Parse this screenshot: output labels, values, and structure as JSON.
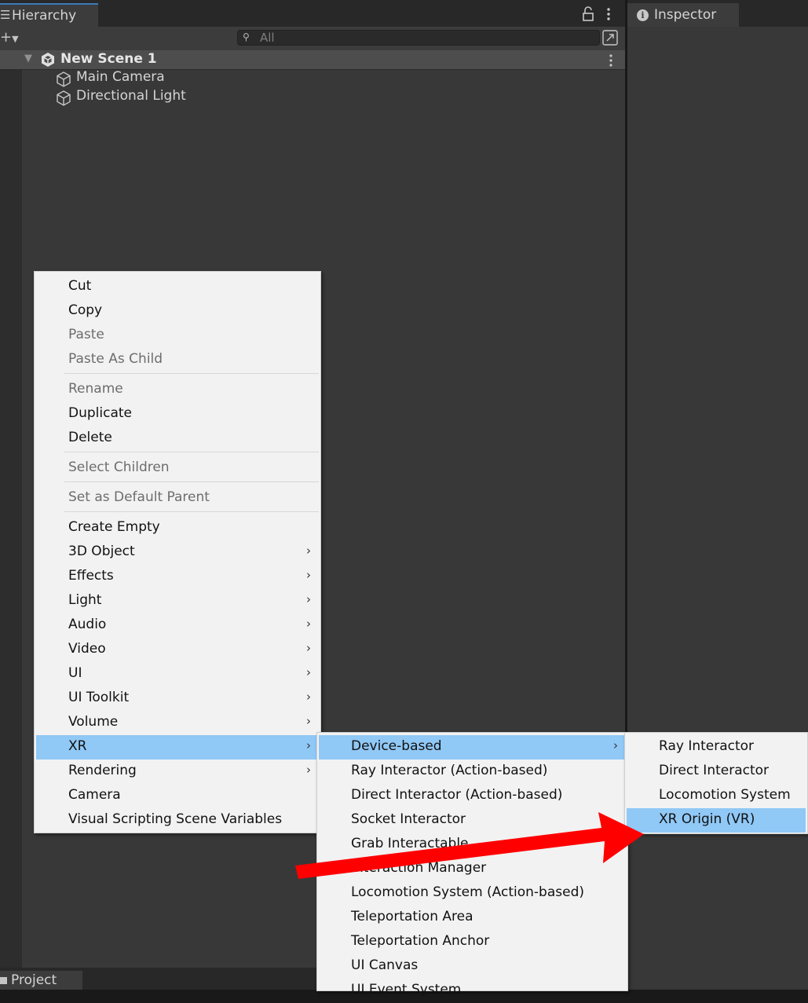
{
  "hierarchy": {
    "tab_label": "Hierarchy",
    "search_placeholder": "All",
    "scene_name": "New Scene 1",
    "objects": [
      "Main Camera",
      "Directional Light"
    ]
  },
  "inspector": {
    "tab_label": "Inspector"
  },
  "project": {
    "tab_label": "Project"
  },
  "context_menu": {
    "items": [
      {
        "label": "Cut",
        "enabled": true
      },
      {
        "label": "Copy",
        "enabled": true
      },
      {
        "label": "Paste",
        "enabled": false
      },
      {
        "label": "Paste As Child",
        "enabled": false
      },
      {
        "label": "Rename",
        "enabled": false
      },
      {
        "label": "Duplicate",
        "enabled": true
      },
      {
        "label": "Delete",
        "enabled": true
      },
      {
        "label": "Select Children",
        "enabled": false
      },
      {
        "label": "Set as Default Parent",
        "enabled": false
      },
      {
        "label": "Create Empty",
        "enabled": true
      },
      {
        "label": "3D Object",
        "enabled": true,
        "submenu": true
      },
      {
        "label": "Effects",
        "enabled": true,
        "submenu": true
      },
      {
        "label": "Light",
        "enabled": true,
        "submenu": true
      },
      {
        "label": "Audio",
        "enabled": true,
        "submenu": true
      },
      {
        "label": "Video",
        "enabled": true,
        "submenu": true
      },
      {
        "label": "UI",
        "enabled": true,
        "submenu": true
      },
      {
        "label": "UI Toolkit",
        "enabled": true,
        "submenu": true
      },
      {
        "label": "Volume",
        "enabled": true,
        "submenu": true
      },
      {
        "label": "XR",
        "enabled": true,
        "submenu": true,
        "highlighted": true
      },
      {
        "label": "Rendering",
        "enabled": true,
        "submenu": true
      },
      {
        "label": "Camera",
        "enabled": true
      },
      {
        "label": "Visual Scripting Scene Variables",
        "enabled": true
      }
    ]
  },
  "xr_submenu": {
    "items": [
      {
        "label": "Device-based",
        "submenu": true,
        "highlighted": true
      },
      {
        "label": "Ray Interactor (Action-based)"
      },
      {
        "label": "Direct Interactor (Action-based)"
      },
      {
        "label": "Socket Interactor"
      },
      {
        "label": "Grab Interactable"
      },
      {
        "label": "Interaction Manager"
      },
      {
        "label": "Locomotion System (Action-based)"
      },
      {
        "label": "Teleportation Area"
      },
      {
        "label": "Teleportation Anchor"
      },
      {
        "label": "UI Canvas"
      },
      {
        "label": "UI Event System"
      }
    ]
  },
  "device_based_submenu": {
    "items": [
      {
        "label": "Ray Interactor"
      },
      {
        "label": "Direct Interactor"
      },
      {
        "label": "Locomotion System"
      },
      {
        "label": "XR Origin (VR)",
        "highlighted": true
      }
    ]
  },
  "colors": {
    "menu_bg": "#f2f2f2",
    "menu_highlight": "#90c8f6",
    "annotation_arrow": "#ff0000",
    "editor_bg": "#383838"
  }
}
